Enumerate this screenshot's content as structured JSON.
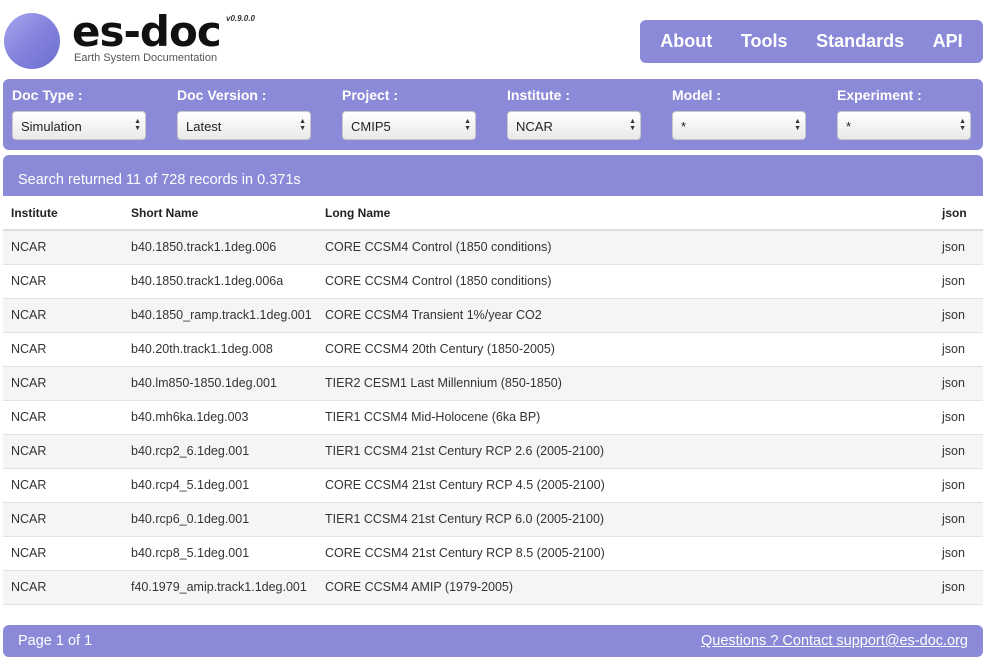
{
  "brand": {
    "name": "es-doc",
    "version": "v0.9.0.0",
    "subtitle": "Earth System Documentation"
  },
  "nav": {
    "items": [
      "About",
      "Tools",
      "Standards",
      "API"
    ]
  },
  "filters": [
    {
      "label": "Doc Type :",
      "value": "Simulation"
    },
    {
      "label": "Doc Version :",
      "value": "Latest"
    },
    {
      "label": "Project :",
      "value": "CMIP5"
    },
    {
      "label": "Institute :",
      "value": "NCAR"
    },
    {
      "label": "Model :",
      "value": "*"
    },
    {
      "label": "Experiment :",
      "value": "*"
    }
  ],
  "search": {
    "summary": "Search returned 11 of 728 records in 0.371s"
  },
  "table": {
    "headers": [
      "Institute",
      "Short Name",
      "Long Name",
      "json"
    ],
    "rows": [
      [
        "NCAR",
        "b40.1850.track1.1deg.006",
        "CORE CCSM4 Control (1850 conditions)",
        "json"
      ],
      [
        "NCAR",
        "b40.1850.track1.1deg.006a",
        "CORE CCSM4 Control (1850 conditions)",
        "json"
      ],
      [
        "NCAR",
        "b40.1850_ramp.track1.1deg.001",
        "CORE CCSM4 Transient 1%/year CO2",
        "json"
      ],
      [
        "NCAR",
        "b40.20th.track1.1deg.008",
        "CORE CCSM4 20th Century (1850-2005)",
        "json"
      ],
      [
        "NCAR",
        "b40.lm850-1850.1deg.001",
        "TIER2 CESM1 Last Millennium (850-1850)",
        "json"
      ],
      [
        "NCAR",
        "b40.mh6ka.1deg.003",
        "TIER1 CCSM4 Mid-Holocene (6ka BP)",
        "json"
      ],
      [
        "NCAR",
        "b40.rcp2_6.1deg.001",
        "TIER1 CCSM4 21st Century RCP 2.6 (2005-2100)",
        "json"
      ],
      [
        "NCAR",
        "b40.rcp4_5.1deg.001",
        "CORE CCSM4 21st Century RCP 4.5 (2005-2100)",
        "json"
      ],
      [
        "NCAR",
        "b40.rcp6_0.1deg.001",
        "TIER1 CCSM4 21st Century RCP 6.0 (2005-2100)",
        "json"
      ],
      [
        "NCAR",
        "b40.rcp8_5.1deg.001",
        "CORE CCSM4 21st Century RCP 8.5 (2005-2100)",
        "json"
      ],
      [
        "NCAR",
        "f40.1979_amip.track1.1deg.001",
        "CORE CCSM4 AMIP (1979-2005)",
        "json"
      ]
    ]
  },
  "footer": {
    "page": "Page 1 of 1",
    "contact": "Questions ? Contact support@es-doc.org"
  },
  "colors": {
    "accent": "#8a8ad9",
    "logo_circle": "#8383dd"
  }
}
